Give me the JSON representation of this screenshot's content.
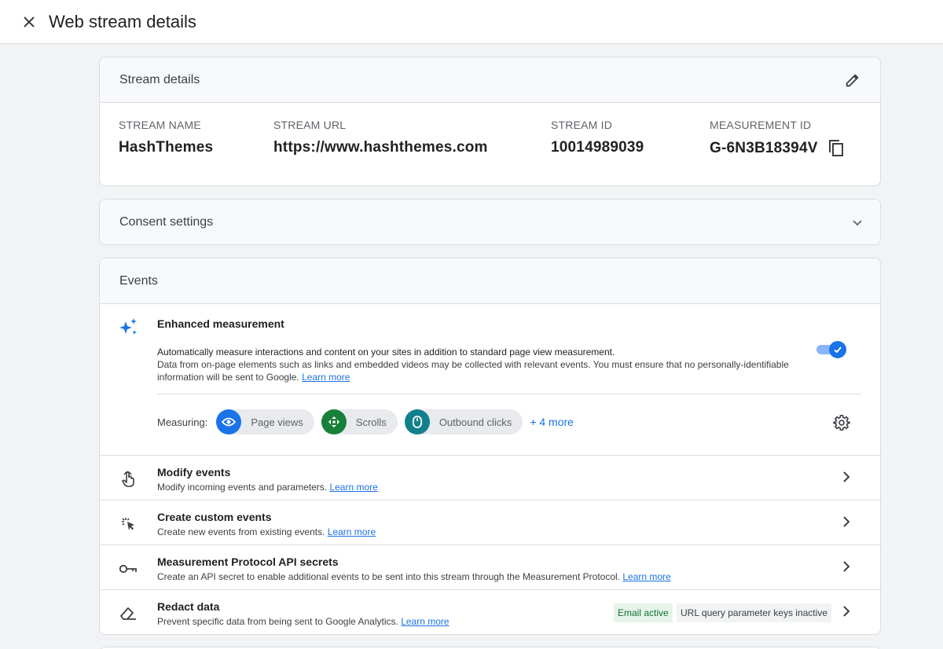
{
  "header": {
    "title": "Web stream details",
    "close_icon": "close-icon"
  },
  "stream_details": {
    "heading": "Stream details",
    "edit_icon": "pencil-icon",
    "fields": [
      {
        "label": "STREAM NAME",
        "value": "HashThemes"
      },
      {
        "label": "STREAM URL",
        "value": "https://www.hashthemes.com"
      },
      {
        "label": "STREAM ID",
        "value": "10014989039"
      },
      {
        "label": "MEASUREMENT ID",
        "value": "G-6N3B18394V"
      }
    ],
    "copy_icon": "copy-icon"
  },
  "consent": {
    "heading": "Consent settings",
    "chevron_icon": "chevron-down-icon"
  },
  "events": {
    "heading": "Events",
    "enhanced": {
      "title": "Enhanced measurement",
      "desc_line1": "Automatically measure interactions and content on your sites in addition to standard page view measurement.",
      "desc_line2": "Data from on-page elements such as links and embedded videos may be collected with relevant events. You must ensure that no personally-identifiable information will be sent to Google.",
      "learn_more": "Learn more",
      "toggle_on": true,
      "measuring_label": "Measuring:",
      "chips": [
        {
          "label": "Page views",
          "icon": "eye-icon",
          "color": "#1a73e8"
        },
        {
          "label": "Scrolls",
          "icon": "scroll-arrows-icon",
          "color": "#188038"
        },
        {
          "label": "Outbound clicks",
          "icon": "mouse-icon",
          "color": "#12808c"
        }
      ],
      "more": "+ 4 more"
    },
    "rows": [
      {
        "title": "Modify events",
        "desc": "Modify incoming events and parameters.",
        "link": "Learn more",
        "icon": "touch-hand-icon"
      },
      {
        "title": "Create custom events",
        "desc": "Create new events from existing events.",
        "link": "Learn more",
        "icon": "sparkle-cursor-icon"
      },
      {
        "title": "Measurement Protocol API secrets",
        "desc": "Create an API secret to enable additional events to be sent into this stream through the Measurement Protocol.",
        "link": "Learn more",
        "icon": "key-icon"
      },
      {
        "title": "Redact data",
        "desc": "Prevent specific data from being sent to Google Analytics.",
        "link": "Learn more",
        "icon": "eraser-icon",
        "badges": [
          "Email active",
          "URL query parameter keys inactive"
        ]
      }
    ]
  },
  "colors": {
    "accent": "#1a73e8",
    "page_bg": "#f1f3f4"
  }
}
